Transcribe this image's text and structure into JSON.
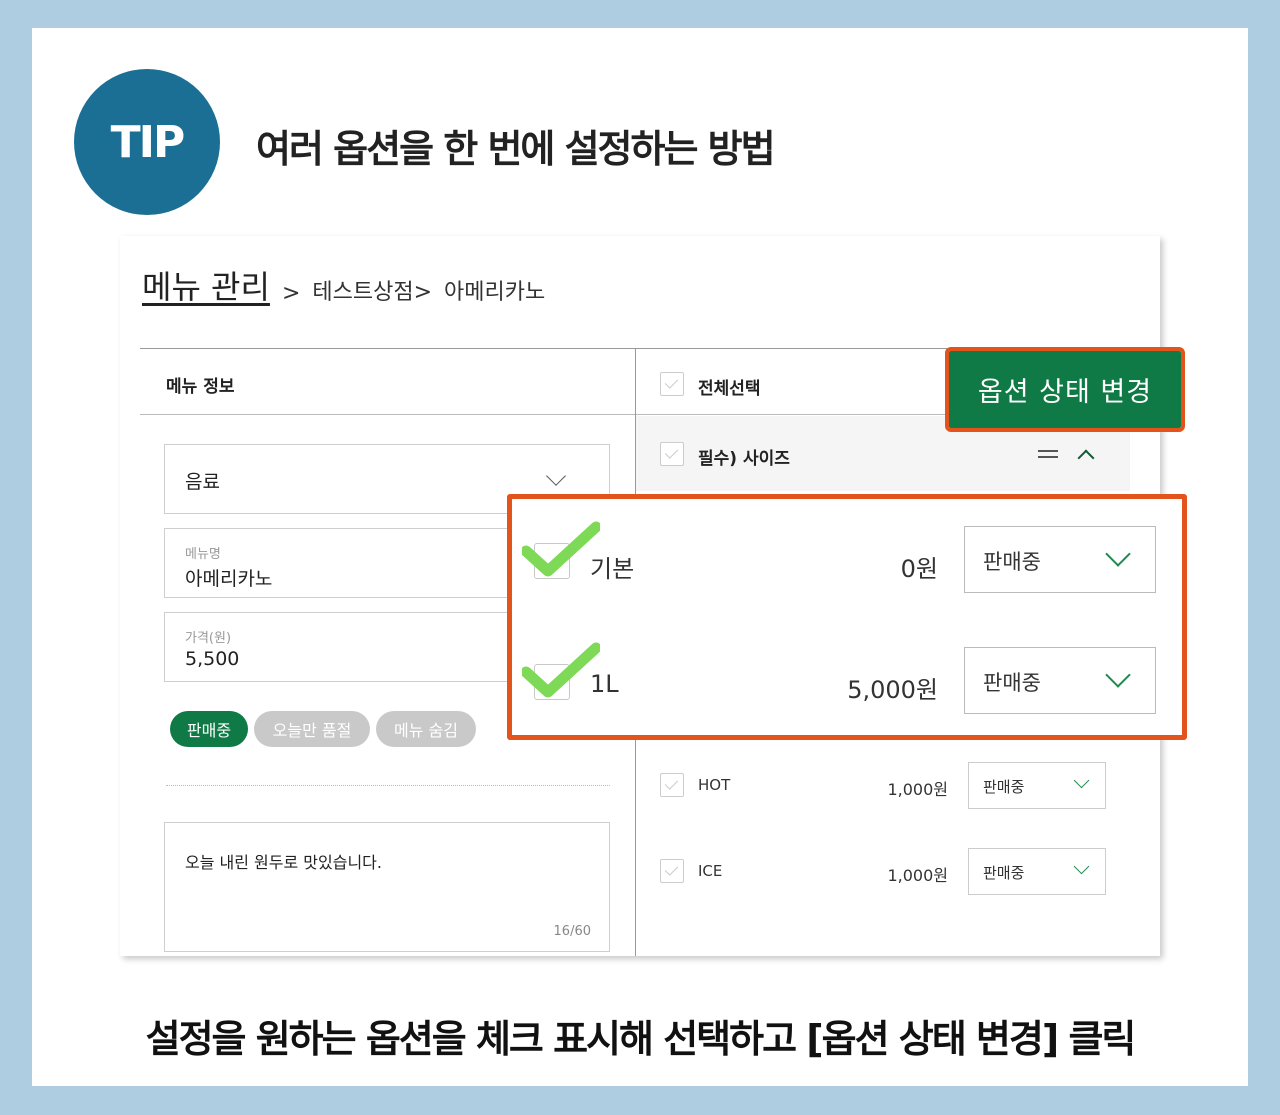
{
  "tip": {
    "badge": "TIP",
    "title": "여러 옵션을 한 번에 설정하는 방법"
  },
  "breadcrumb": {
    "root": "메뉴 관리",
    "sep": ">",
    "store": "테스트상점>",
    "item": "아메리카노"
  },
  "menu_info": {
    "header": "메뉴 정보",
    "category": "음료",
    "name_label": "메뉴명",
    "name_value": "아메리카노",
    "price_label": "가격(원)",
    "price_value": "5,500",
    "status_chips": [
      "판매중",
      "오늘만 품절",
      "메뉴 숨김"
    ],
    "description": "오늘 내린 원두로 맛있습니다.",
    "char_count": "16/60"
  },
  "options": {
    "select_all": "전체선택",
    "change_status_button": "옵션 상태 변경",
    "group_label": "필수) 사이즈",
    "rows": [
      {
        "label": "기본",
        "price": "0원",
        "status": "판매중"
      },
      {
        "label": "1L",
        "price": "5,000원",
        "status": "판매중"
      },
      {
        "label": "HOT",
        "price": "1,000원",
        "status": "판매중"
      },
      {
        "label": "ICE",
        "price": "1,000원",
        "status": "판매중"
      }
    ]
  },
  "colors": {
    "brand_green": "#0f7a45",
    "highlight": "#e4531c",
    "tip_blue": "#1b6f95",
    "check_green": "#7ed957"
  },
  "footer": "설정을 원하는 옵션을 체크 표시해 선택하고 [옵션 상태 변경] 클릭"
}
